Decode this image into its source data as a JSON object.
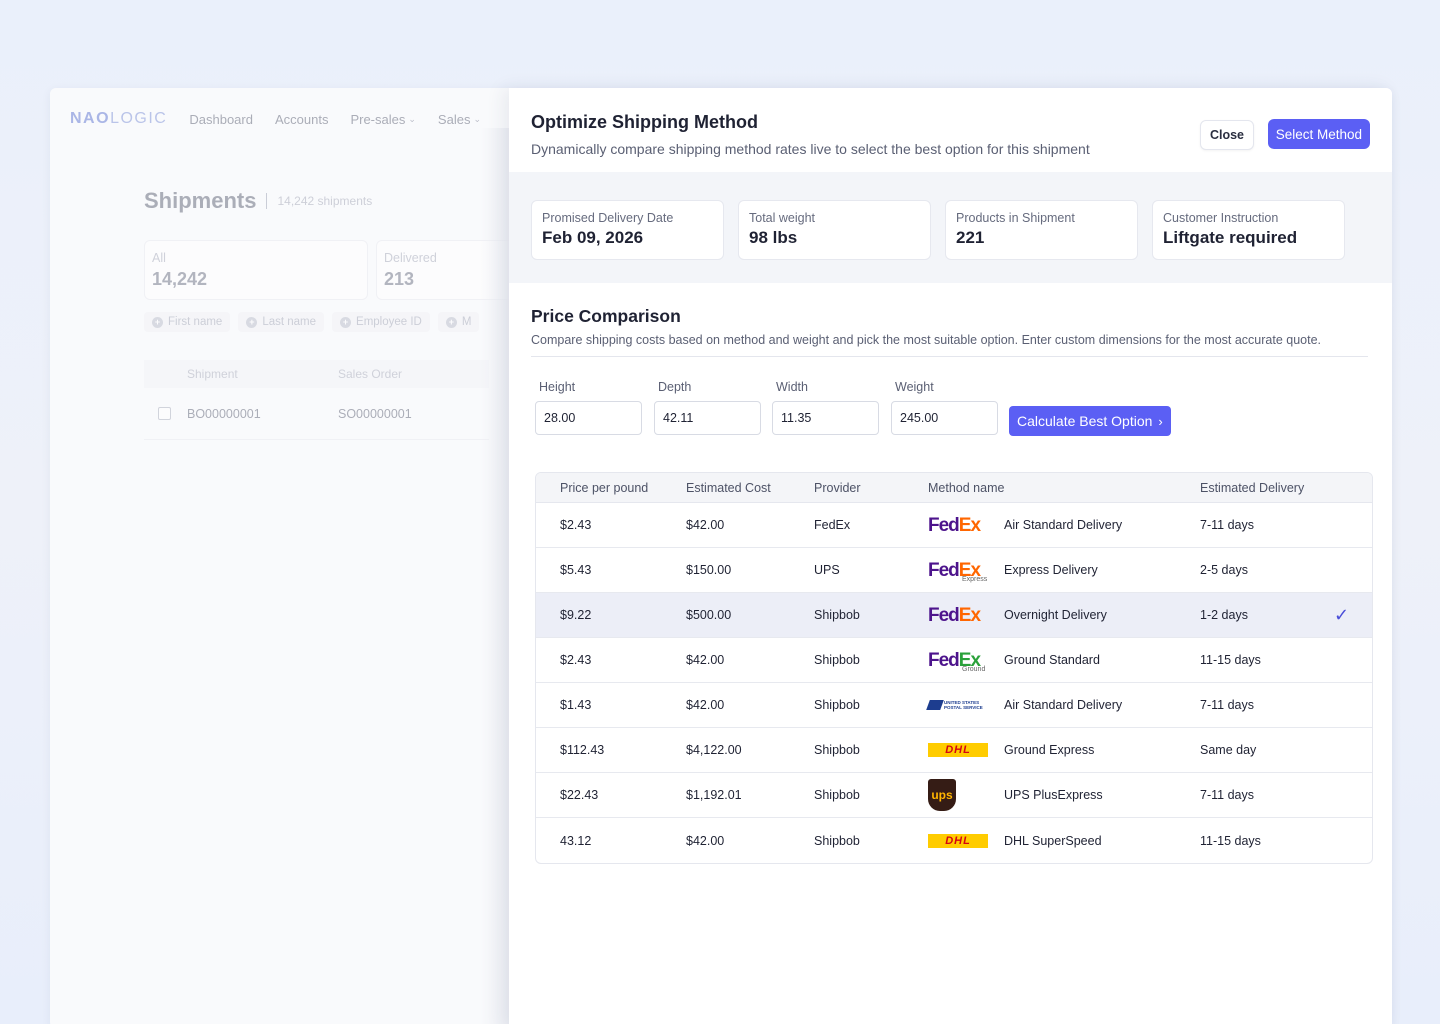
{
  "bg_app": {
    "logo": {
      "bold": "NAO",
      "rest": "LOGIC"
    },
    "nav": [
      {
        "label": "Dashboard",
        "chevron": false
      },
      {
        "label": "Accounts",
        "chevron": false
      },
      {
        "label": "Pre-sales",
        "chevron": true
      },
      {
        "label": "Sales",
        "chevron": true
      }
    ],
    "page_title": "Shipments",
    "page_count": "14,242 shipments",
    "stats": [
      {
        "label": "All",
        "value": "14,242"
      },
      {
        "label": "Delivered",
        "value": "213"
      }
    ],
    "filters": [
      "First name",
      "Last name",
      "Employee ID",
      "M"
    ],
    "table_headers": [
      "Shipment",
      "Sales Order"
    ],
    "rows": [
      {
        "shipment": "BO00000001",
        "sales_order": "SO00000001"
      }
    ]
  },
  "modal": {
    "title": "Optimize Shipping Method",
    "subtitle": "Dynamically compare shipping method rates live to select the best option for this shipment",
    "close_label": "Close",
    "select_label": "Select Method",
    "summary": [
      {
        "label": "Promised Delivery Date",
        "value": "Feb 09, 2026"
      },
      {
        "label": "Total weight",
        "value": "98 lbs"
      },
      {
        "label": "Products in Shipment",
        "value": "221"
      },
      {
        "label": "Customer Instruction",
        "value": "Liftgate required"
      }
    ],
    "price_comparison": {
      "title": "Price Comparison",
      "subtitle": "Compare shipping costs based on method and weight and pick the most suitable option. Enter custom dimensions for the most accurate quote.",
      "fields": [
        {
          "label": "Height",
          "value": "28.00"
        },
        {
          "label": "Depth",
          "value": "42.11"
        },
        {
          "label": "Width",
          "value": "11.35"
        },
        {
          "label": "Weight",
          "value": "245.00"
        }
      ],
      "calc_label": "Calculate Best Option",
      "headers": [
        "Price per pound",
        "Estimated Cost",
        "Provider",
        "Method name",
        "Estimated Delivery"
      ],
      "rows": [
        {
          "ppp": "$2.43",
          "cost": "$42.00",
          "provider": "FedEx",
          "logo": "fedex",
          "method": "Air Standard Delivery",
          "delivery": "7-11 days",
          "selected": false
        },
        {
          "ppp": "$5.43",
          "cost": "$150.00",
          "provider": "UPS",
          "logo": "fedex-express",
          "method": "Express Delivery",
          "delivery": "2-5 days",
          "selected": false
        },
        {
          "ppp": "$9.22",
          "cost": "$500.00",
          "provider": "Shipbob",
          "logo": "fedex",
          "method": "Overnight Delivery",
          "delivery": "1-2 days",
          "selected": true
        },
        {
          "ppp": "$2.43",
          "cost": "$42.00",
          "provider": "Shipbob",
          "logo": "fedex-ground",
          "method": "Ground Standard",
          "delivery": "11-15 days",
          "selected": false
        },
        {
          "ppp": "$1.43",
          "cost": "$42.00",
          "provider": "Shipbob",
          "logo": "usps",
          "method": "Air Standard Delivery",
          "delivery": "7-11 days",
          "selected": false
        },
        {
          "ppp": "$112.43",
          "cost": "$4,122.00",
          "provider": "Shipbob",
          "logo": "dhl",
          "method": "Ground Express",
          "delivery": "Same day",
          "selected": false
        },
        {
          "ppp": "$22.43",
          "cost": "$1,192.01",
          "provider": "Shipbob",
          "logo": "ups",
          "method": "UPS PlusExpress",
          "delivery": "7-11 days",
          "selected": false
        },
        {
          "ppp": "43.12",
          "cost": "$42.00",
          "provider": "Shipbob",
          "logo": "dhl",
          "method": "DHL SuperSpeed",
          "delivery": "11-15 days",
          "selected": false
        }
      ]
    },
    "logo_text": {
      "fedex_fe": "Fed",
      "fedex_ex": "Ex",
      "fedex_express_sub": "Express",
      "fedex_ground_sub": "Ground",
      "usps": "UNITED STATES POSTAL SERVICE",
      "dhl": "DHL",
      "ups": "ups"
    },
    "colors": {
      "accent": "#5b5ff4",
      "selected_row": "#eceef7"
    }
  }
}
